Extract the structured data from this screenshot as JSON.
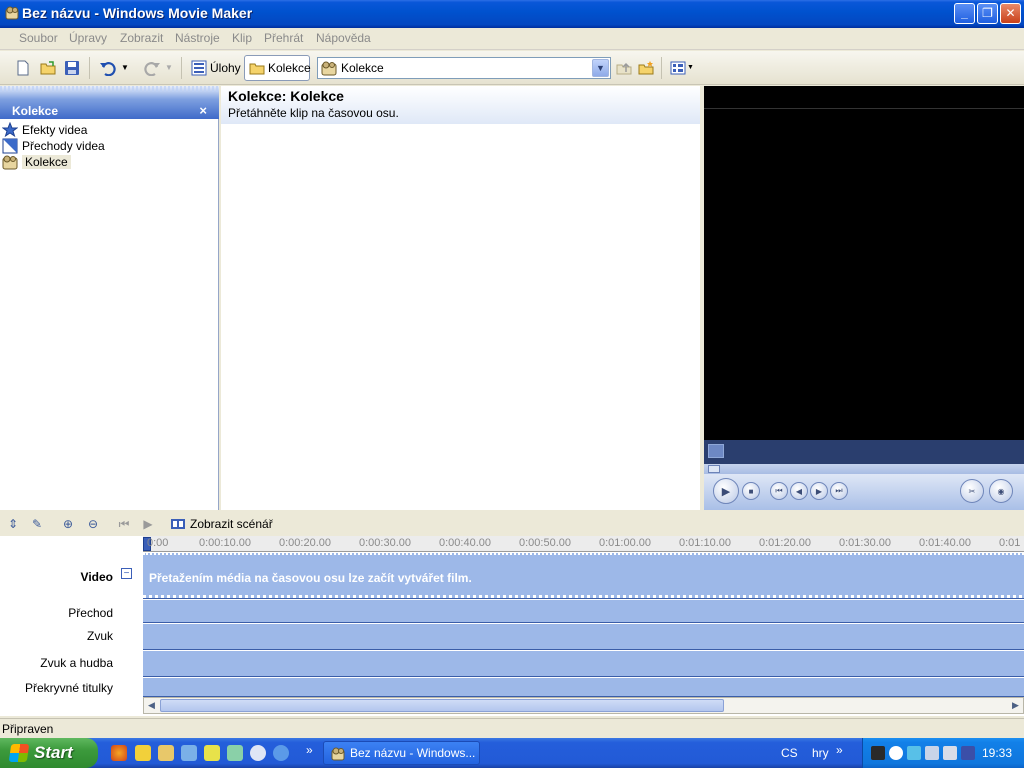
{
  "window": {
    "title": "Bez názvu - Windows Movie Maker",
    "controls": {
      "minimize": "_",
      "maximize": "❐",
      "close": "✕"
    }
  },
  "menu": [
    "Soubor",
    "Úpravy",
    "Zobrazit",
    "Nástroje",
    "Klip",
    "Přehrát",
    "Nápověda"
  ],
  "toolbar": {
    "tasks_label": "Úlohy",
    "collections_label": "Kolekce",
    "folder_select": "Kolekce"
  },
  "task_pane": {
    "title": "Kolekce",
    "close": "×",
    "items": [
      {
        "label": "Efekty videa",
        "icon": "star-icon"
      },
      {
        "label": "Přechody videa",
        "icon": "transition-icon"
      },
      {
        "label": "Kolekce",
        "icon": "collection-icon",
        "selected": true
      }
    ]
  },
  "collection": {
    "title": "Kolekce: Kolekce",
    "subtitle": "Přetáhněte klip na časovou osu."
  },
  "timeline": {
    "storyboard_label": "Zobrazit scénář",
    "ruler": [
      "0:00",
      "0:00:10.00",
      "0:00:20.00",
      "0:00:30.00",
      "0:00:40.00",
      "0:00:50.00",
      "0:01:00.00",
      "0:01:10.00",
      "0:01:20.00",
      "0:01:30.00",
      "0:01:40.00",
      "0:01"
    ],
    "tracks": {
      "video": "Video",
      "transition": "Přechod",
      "audio": "Zvuk",
      "audio_music": "Zvuk a hudba",
      "titles": "Překryvné titulky"
    },
    "collapse": "−",
    "empty_message": "Přetažením média na časovou osu lze začít vytvářet film."
  },
  "status": {
    "text": "Připraven"
  },
  "taskbar": {
    "start": "Start",
    "task_item": "Bez názvu - Windows...",
    "lang": "CS",
    "toolbar_name": "hry",
    "clock": "19:33",
    "chevron": "»"
  }
}
